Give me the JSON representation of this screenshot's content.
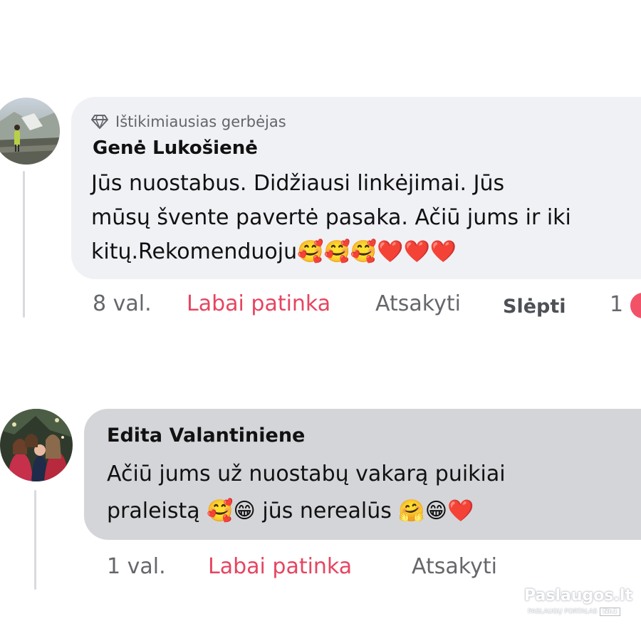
{
  "comments": [
    {
      "badge": "Ištikimiausias gerbėjas",
      "author": "Genė Lukošienė",
      "lines": [
        "Jūs nuostabus. Didžiausi linkėjimai. Jūs",
        "mūsų švente pavertė pasaka. Ačiū jums ir iki",
        "kitų.Rekomenduoju🥰🥰🥰❤️❤️❤️"
      ],
      "time": "8 val.",
      "like_label": "Labai patinka",
      "reply_label": "Atsakyti",
      "hide_label": "Slėpti",
      "reaction_count": "1"
    },
    {
      "author": "Edita Valantiniene",
      "lines": [
        "Ačiū jums už nuostabų vakarą puikiai",
        "praleistą 🥰😁 jūs nerealūs 🤗😁❤️"
      ],
      "time": "1 val.",
      "like_label": "Labai patinka",
      "reply_label": "Atsakyti"
    }
  ],
  "watermark": {
    "title": "Paslaugos.lt",
    "subtitle": "PASLAUGŲ PORTALAS",
    "rank": "Nr.1"
  },
  "colors": {
    "like": "#e64560",
    "bubble_light": "#f0f1f5",
    "bubble_dark": "#d4d5d9",
    "reaction": "#f25268"
  },
  "icons": {
    "badge": "diamond-icon",
    "reaction": "heart-reaction-icon"
  }
}
